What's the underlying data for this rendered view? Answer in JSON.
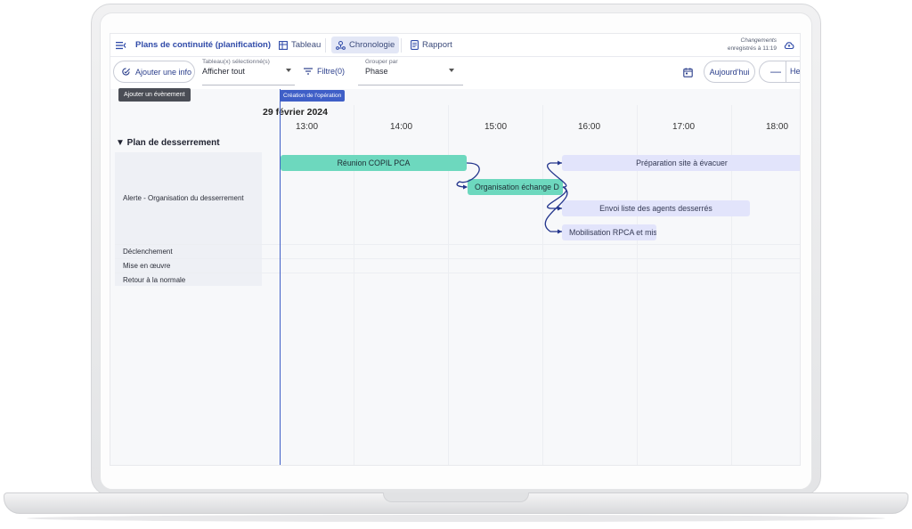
{
  "app": {
    "menu_icon": "menu-collapse-icon",
    "title": "Plans de continuité (planification)",
    "views": [
      {
        "label": "Tableau",
        "icon": "table-icon"
      },
      {
        "label": "Chronologie",
        "icon": "timeline-icon"
      },
      {
        "label": "Rapport",
        "icon": "document-icon"
      }
    ],
    "save_status_line1": "Changements",
    "save_status_line2": "enregistrés à 11:19",
    "cloud_icon": "cloud-sync-icon"
  },
  "toolbar": {
    "add_info_label": "Ajouter une info",
    "add_info_tooltip": "Ajouter un évènement",
    "boards_label": "Tableau(x) sélectionné(s)",
    "boards_value": "Afficher tout",
    "filter_label": "Filtre(0)",
    "group_label": "Grouper par",
    "group_value": "Phase",
    "today_label": "Aujourd'hui",
    "zoom_minus": "—",
    "zoom_unit": "Heu"
  },
  "timeline": {
    "now_tag": "Création de l'opération",
    "date": "29 février 2024",
    "hours": [
      "13:00",
      "14:00",
      "15:00",
      "16:00",
      "17:00",
      "18:00"
    ],
    "group_title": "▼ Plan de desserrement",
    "lanes": [
      "Alerte - Organisation du desserrement",
      "Déclenchement",
      "Mise en œuvre",
      "Retour à la normale"
    ],
    "events": [
      {
        "label": "Réunion COPIL PCA",
        "color": "#6dd8be"
      },
      {
        "label": "Organisation échange D",
        "color": "#6dd8be"
      },
      {
        "label": "Préparation site à évacuer",
        "color": "#e2e4fb"
      },
      {
        "label": "Envoi liste des agents desserrés",
        "color": "#e2e4fb"
      },
      {
        "label": "Mobilisation RPCA et mis",
        "color": "#e2e4fb"
      }
    ],
    "accent_color": "#3f5fc7"
  }
}
